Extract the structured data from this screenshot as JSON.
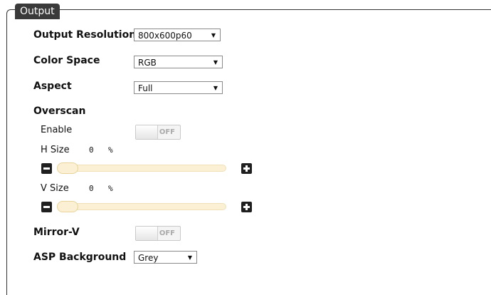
{
  "section": {
    "title": "Output"
  },
  "output_resolution": {
    "label": "Output Resolution",
    "value": "800x600p60"
  },
  "color_space": {
    "label": "Color Space",
    "value": "RGB"
  },
  "aspect": {
    "label": "Aspect",
    "value": "Full"
  },
  "overscan": {
    "label": "Overscan",
    "enable": {
      "label": "Enable",
      "state": "OFF"
    },
    "h_size": {
      "label": "H Size",
      "value": "0",
      "unit": "%",
      "level": 0
    },
    "v_size": {
      "label": "V Size",
      "value": "0",
      "unit": "%",
      "level": 0
    }
  },
  "mirror_v": {
    "label": "Mirror-V",
    "state": "OFF"
  },
  "asp_background": {
    "label": "ASP Background",
    "value": "Grey"
  },
  "icons": {
    "decrease": "minus-icon",
    "increase": "plus-icon",
    "dropdown": "chevron-down-icon"
  }
}
